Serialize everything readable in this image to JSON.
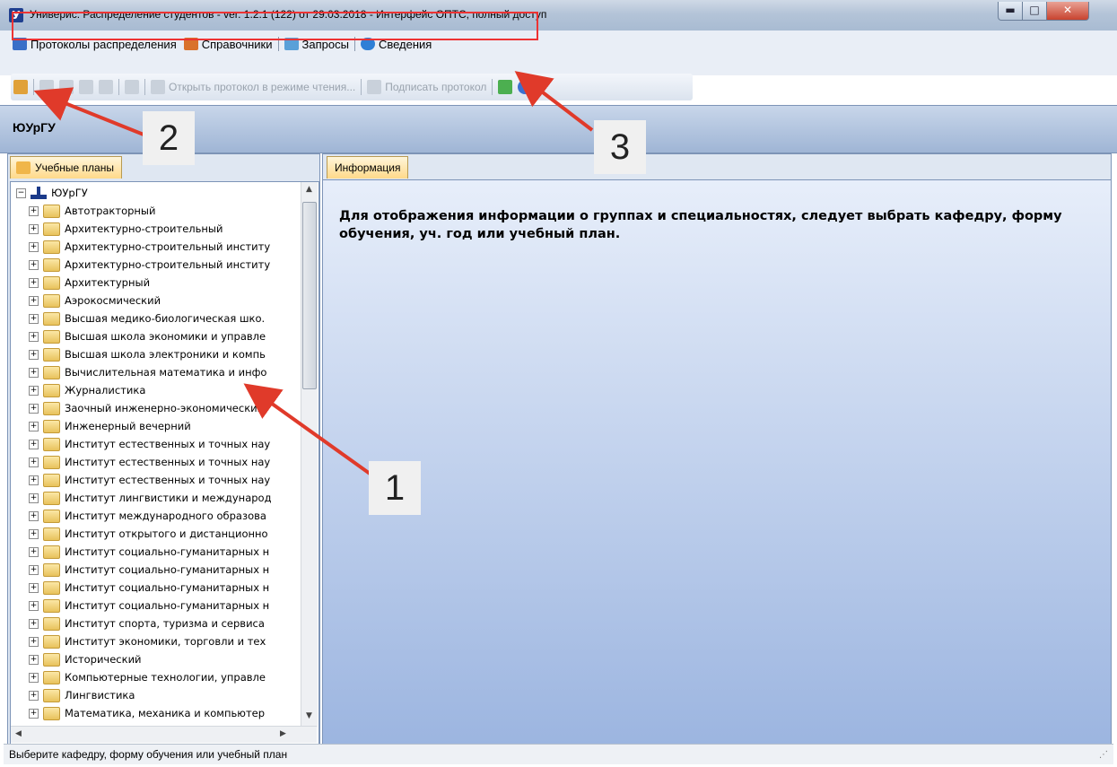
{
  "window": {
    "logo_letter": "У",
    "title": "Универис: Распределение студентов  -  ver. 1.2.1 (122) от 29.03.2018  -  Интерфейс ОПТС, полный доступ",
    "min_glyph": "▬",
    "max_glyph": "□",
    "close_glyph": "✕"
  },
  "menu": [
    {
      "label": "Протоколы распределения",
      "icon": "protocols-icon",
      "color": "#3a6fc8"
    },
    {
      "label": "Справочники",
      "icon": "books-icon",
      "color": "#d9722b"
    },
    {
      "label": "Запросы",
      "icon": "query-icon",
      "color": "#5aa0d8"
    },
    {
      "label": "Сведения",
      "icon": "info-globe-icon",
      "color": "#2f7fd6"
    }
  ],
  "toolbar": {
    "open_readonly_label": "Открыть протокол в режиме чтения...",
    "sign_label": "Подписать протокол"
  },
  "header": {
    "org": "ЮУрГУ"
  },
  "left_tab": {
    "label": "Учебные планы",
    "icon": "study-plans-icon"
  },
  "right_tab": {
    "label": "Информация"
  },
  "tree": {
    "root": "ЮУрГУ",
    "items": [
      "Автотракторный",
      "Архитектурно-строительный",
      "Архитектурно-строительный институ",
      "Архитектурно-строительный институ",
      "Архитектурный",
      "Аэрокосмический",
      "Высшая медико-биологическая шко.",
      "Высшая школа экономики и управле",
      "Высшая школа электроники и компь",
      "Вычислительная математика и инфо",
      "Журналистика",
      "Заочный инженерно-экономический",
      "Инженерный вечерний",
      "Институт естественных и точных нау",
      "Институт естественных и точных нау",
      "Институт естественных и точных нау",
      "Институт лингвистики и международ",
      "Институт международного образова",
      "Институт открытого и дистанционно",
      "Институт социально-гуманитарных н",
      "Институт социально-гуманитарных н",
      "Институт социально-гуманитарных н",
      "Институт социально-гуманитарных н",
      "Институт спорта, туризма и сервиса",
      "Институт экономики, торговли и тех",
      "Исторический",
      "Компьютерные технологии, управле",
      "Лингвистика",
      "Математика, механика и компьютер"
    ]
  },
  "info": {
    "message": "Для отображения информации о группах и специальностях,  следует выбрать кафедру, форму обучения, уч. год или учебный план."
  },
  "status": {
    "text": "Выберите кафедру, форму обучения или учебный план"
  },
  "annotations": {
    "callout_1": "1",
    "callout_2": "2",
    "callout_3": "3",
    "color": "#e03a2a"
  }
}
